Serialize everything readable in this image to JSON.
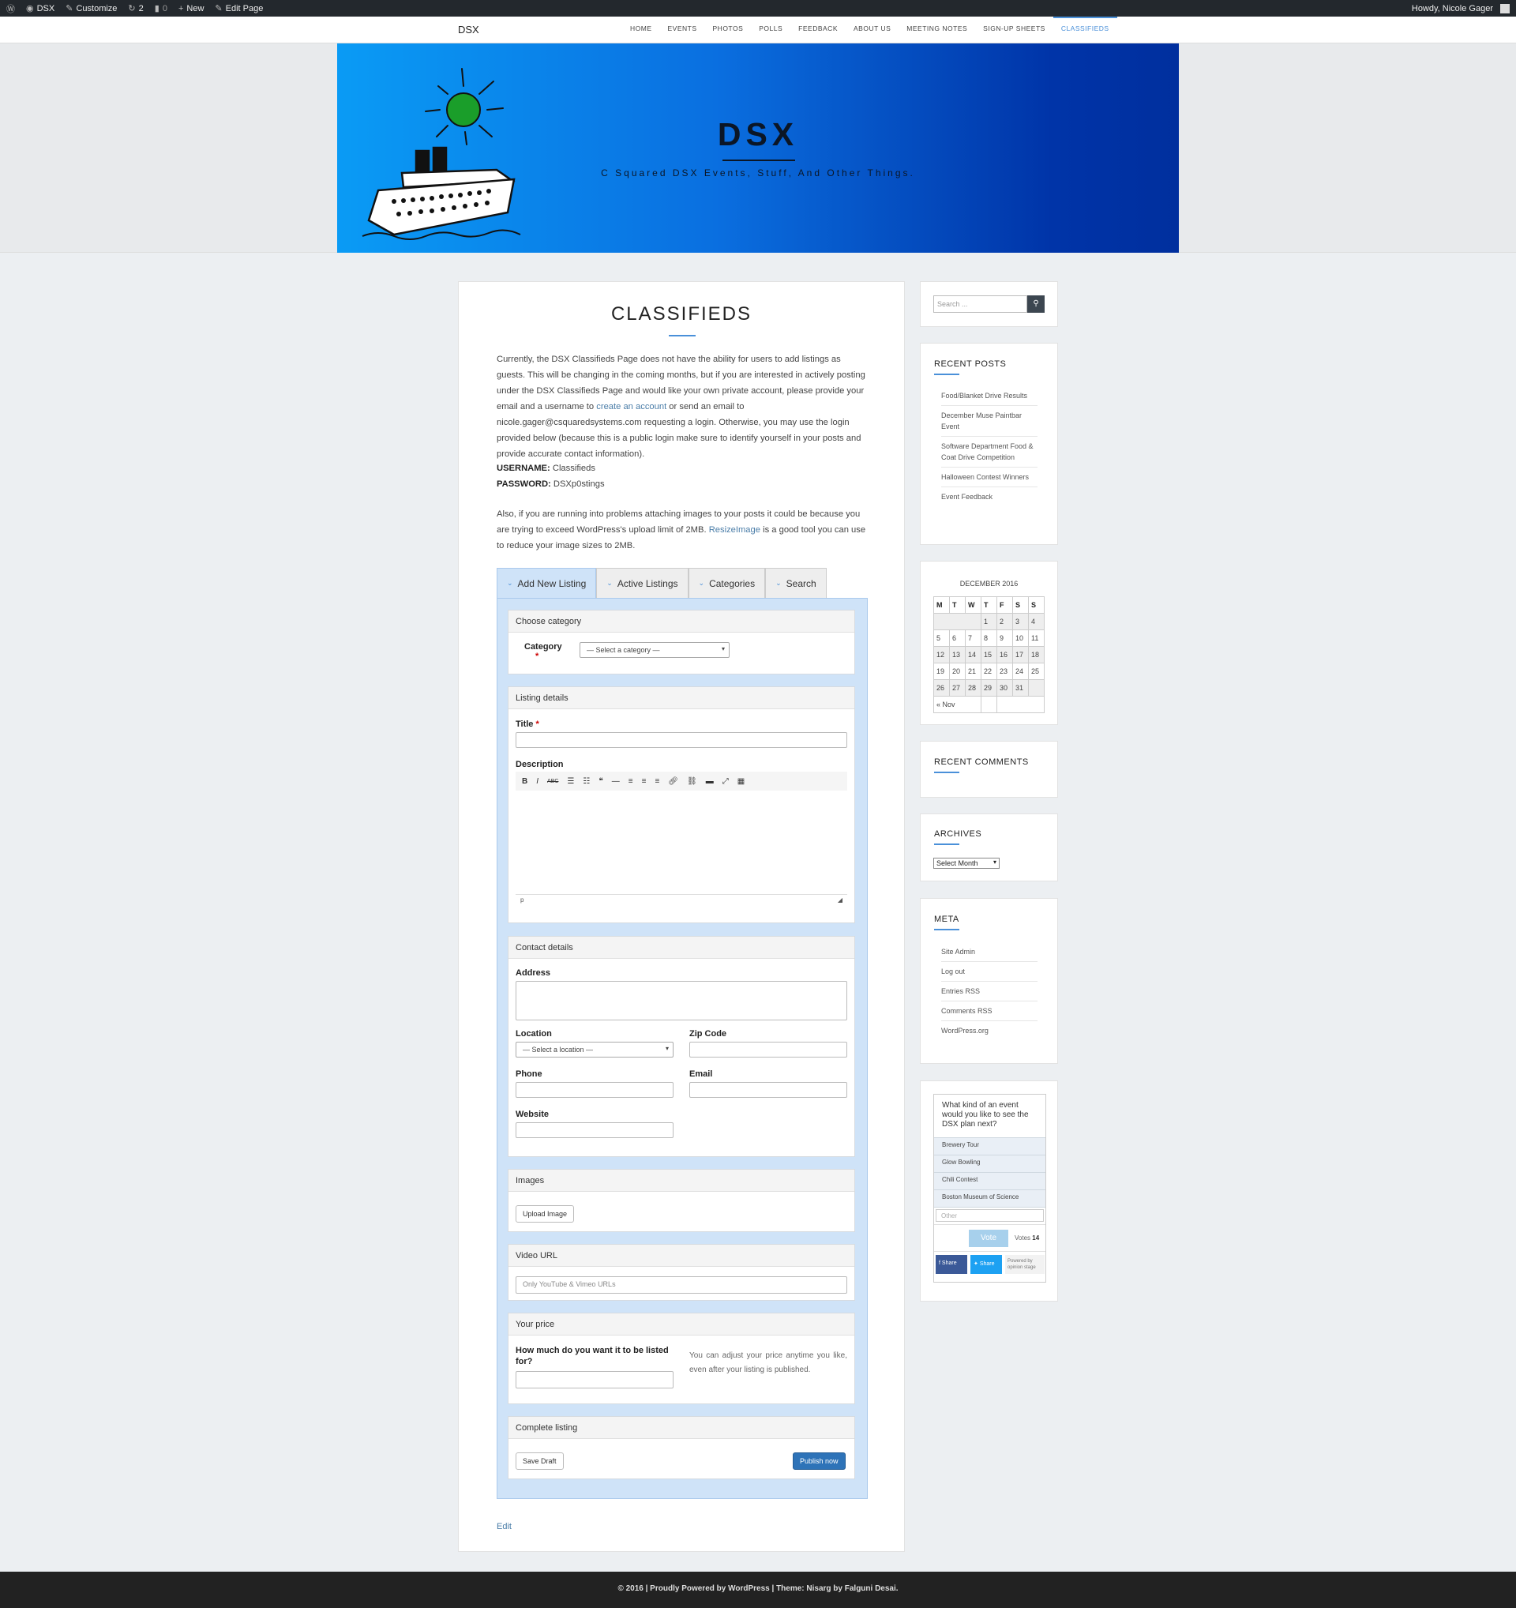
{
  "admin_bar": {
    "site_name": "DSX",
    "customize": "Customize",
    "updates_count": "2",
    "comments_count": "0",
    "new": "New",
    "edit_page": "Edit Page",
    "howdy": "Howdy, Nicole Gager"
  },
  "nav": {
    "brand": "DSX",
    "items": [
      "HOME",
      "EVENTS",
      "PHOTOS",
      "POLLS",
      "FEEDBACK",
      "ABOUT US",
      "MEETING NOTES",
      "SIGN-UP SHEETS",
      "CLASSIFIEDS"
    ],
    "active_index": 8
  },
  "header": {
    "title": "DSX",
    "tagline": "C Squared DSX Events, Stuff, And Other Things."
  },
  "page": {
    "title": "CLASSIFIEDS",
    "intro_1": "Currently, the DSX Classifieds Page does not have the ability for users to add listings as guests. This will be changing in the coming months, but if you are interested in actively posting under the DSX Classifieds Page and would like your own private account, please provide your email and a username to ",
    "intro_link": "create an account",
    "intro_2": " or send an email to nicole.gager@csquaredsystems.com requesting a login. Otherwise, you may use the login provided below (because this is a public login make sure to identify yourself in your posts and provide accurate contact information).",
    "username_label": "USERNAME:",
    "username": " Classifieds",
    "password_label": "PASSWORD:",
    "password": " DSXp0stings",
    "images_1": "Also, if you are running into problems attaching images to your posts it could be because you are trying to exceed WordPress's upload limit of 2MB. ",
    "images_link": "ResizeImage",
    "images_2": " is a good tool you can use to reduce your image sizes to 2MB.",
    "edit": "Edit"
  },
  "tabs": [
    "Add New Listing",
    "Active Listings",
    "Categories",
    "Search"
  ],
  "form": {
    "choose_category": "Choose category",
    "category_label": "Category",
    "category_placeholder": "— Select a category —",
    "listing_details": "Listing details",
    "title_label": "Title",
    "description_label": "Description",
    "editor_status": "p",
    "contact_details": "Contact details",
    "address_label": "Address",
    "location_label": "Location",
    "location_placeholder": "— Select a location —",
    "zip_label": "Zip Code",
    "phone_label": "Phone",
    "email_label": "Email",
    "website_label": "Website",
    "images": "Images",
    "upload_image": "Upload Image",
    "video_url": "Video URL",
    "video_placeholder": "Only YouTube & Vimeo URLs",
    "your_price": "Your price",
    "price_label": "How much do you want it to be listed for?",
    "price_note": "You can adjust your price anytime you like, even after your listing is published.",
    "complete_listing": "Complete listing",
    "save_draft": "Save Draft",
    "publish": "Publish now"
  },
  "sidebar": {
    "search_placeholder": "Search ...",
    "recent_posts_title": "RECENT POSTS",
    "recent_posts": [
      "Food/Blanket Drive Results",
      "December Muse Paintbar Event",
      "Software Department Food & Coat Drive Competition",
      "Halloween Contest Winners",
      "Event Feedback"
    ],
    "calendar_title": "DECEMBER 2016",
    "calendar_days": [
      "M",
      "T",
      "W",
      "T",
      "F",
      "S",
      "S"
    ],
    "calendar_weeks": [
      [
        "",
        "",
        "",
        "1",
        "2",
        "3",
        "4"
      ],
      [
        "5",
        "6",
        "7",
        "8",
        "9",
        "10",
        "11"
      ],
      [
        "12",
        "13",
        "14",
        "15",
        "16",
        "17",
        "18"
      ],
      [
        "19",
        "20",
        "21",
        "22",
        "23",
        "24",
        "25"
      ],
      [
        "26",
        "27",
        "28",
        "29",
        "30",
        "31",
        ""
      ]
    ],
    "calendar_prev": "« Nov",
    "recent_comments_title": "RECENT COMMENTS",
    "archives_title": "ARCHIVES",
    "archives_select": "Select Month",
    "meta_title": "META",
    "meta_items": [
      "Site Admin",
      "Log out",
      "Entries RSS",
      "Comments RSS",
      "WordPress.org"
    ],
    "poll_question": "What kind of an event would you like to see the DSX plan next?",
    "poll_options": [
      "Brewery Tour",
      "Glow Bowling",
      "Chili Contest",
      "Boston Museum of Science"
    ],
    "poll_other": "Other",
    "poll_vote": "Vote",
    "poll_votes_label": "Votes",
    "poll_votes": "14",
    "share_fb": "Share",
    "share_tw": "Share",
    "powered_by": "Powered by",
    "opinion_stage": "opinion stage"
  },
  "footer": "© 2016 | Proudly Powered by WordPress | Theme: Nisarg by Falguni Desai.",
  "colors": {
    "accent": "#4a90d9",
    "hero_start": "#0a9bf5",
    "hero_end": "#002f9e",
    "admin_bar": "#23282d",
    "publish": "#2e73b8"
  }
}
